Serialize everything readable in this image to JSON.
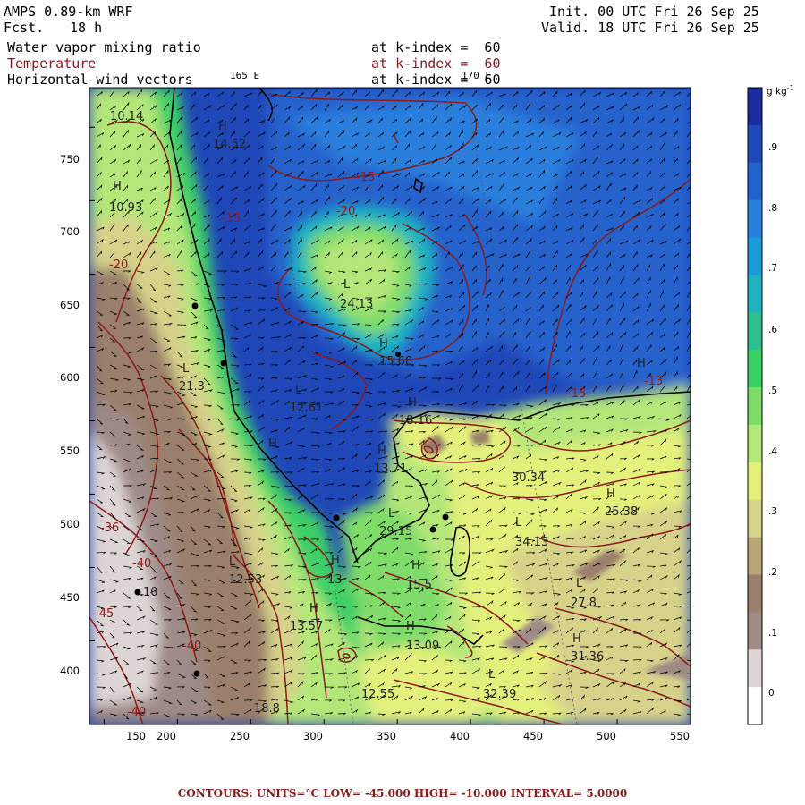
{
  "header": {
    "model": "AMPS 0.89-km WRF",
    "forecast_label": "Fcst.",
    "forecast_value": "18 h",
    "init": "Init. 00 UTC Fri 26 Sep 25",
    "valid": "Valid. 18 UTC Fri 26 Sep 25"
  },
  "fields": [
    {
      "name": "Water vapor mixing ratio",
      "level": "at k-index =  60",
      "color": "#000000"
    },
    {
      "name": "Temperature",
      "level": "at k-index =  60",
      "color": "#8b1a1a"
    },
    {
      "name": "Horizontal wind vectors",
      "level": "at k-index =  60",
      "color": "#000000"
    }
  ],
  "longitude_labels": [
    "165 E",
    "170 E"
  ],
  "axes": {
    "x_ticks": [
      "150",
      "200",
      "250",
      "300",
      "350",
      "400",
      "450",
      "500",
      "550"
    ],
    "y_ticks": [
      "750",
      "700",
      "650",
      "600",
      "550",
      "500",
      "450",
      "400"
    ]
  },
  "colorbar": {
    "unit": "g kg",
    "unit_sup": "-1",
    "labels": [
      ".9",
      ".8",
      ".7",
      ".6",
      ".5",
      ".4",
      ".3",
      ".2",
      ".1",
      "0"
    ],
    "colors": [
      "#1a2d9a",
      "#1f47b8",
      "#2562cc",
      "#2a7fdd",
      "#1b9bd6",
      "#1fb3bf",
      "#2ebf8c",
      "#3ccf66",
      "#7fdc6a",
      "#b4e67a",
      "#e4f07c",
      "#d6d28a",
      "#b8a77a",
      "#9a7f6c",
      "#9e8a86",
      "#ddd5d4",
      "#ffffff"
    ]
  },
  "map_labels": [
    {
      "text": "10.14",
      "kind": "value"
    },
    {
      "text": "14.52",
      "kind": "value"
    },
    {
      "text": "-15",
      "kind": "contour"
    },
    {
      "text": "10.93",
      "kind": "value"
    },
    {
      "text": "-20",
      "kind": "contour"
    },
    {
      "text": "-15",
      "kind": "contour"
    },
    {
      "text": "-20",
      "kind": "contour"
    },
    {
      "text": "24.13",
      "kind": "value"
    },
    {
      "text": "15.68",
      "kind": "value"
    },
    {
      "text": "21.3",
      "kind": "value"
    },
    {
      "text": "12.61",
      "kind": "value"
    },
    {
      "text": "18.16",
      "kind": "value"
    },
    {
      "text": "-15",
      "kind": "contour"
    },
    {
      "text": "-13",
      "kind": "contour"
    },
    {
      "text": "13.71",
      "kind": "value"
    },
    {
      "text": "30.34",
      "kind": "value"
    },
    {
      "text": "25.38",
      "kind": "value"
    },
    {
      "text": "-36",
      "kind": "contour"
    },
    {
      "text": "29.15",
      "kind": "value"
    },
    {
      "text": "34.13",
      "kind": "value"
    },
    {
      "text": "-40",
      "kind": "contour"
    },
    {
      "text": "12.53",
      "kind": "value"
    },
    {
      "text": "15.5",
      "kind": "value"
    },
    {
      "text": "13",
      "kind": "value"
    },
    {
      "text": "-45",
      "kind": "contour"
    },
    {
      "text": "10",
      "kind": "value"
    },
    {
      "text": "27.8",
      "kind": "value"
    },
    {
      "text": "13.57",
      "kind": "value"
    },
    {
      "text": "13.09",
      "kind": "value"
    },
    {
      "text": "31.36",
      "kind": "value"
    },
    {
      "text": "-40",
      "kind": "contour"
    },
    {
      "text": "32.39",
      "kind": "value"
    },
    {
      "text": "12.55",
      "kind": "value"
    },
    {
      "text": "-40",
      "kind": "contour"
    },
    {
      "text": "18.8",
      "kind": "value"
    }
  ],
  "map_markers": [
    "H",
    "H",
    "L",
    "H",
    "L",
    "L",
    "H",
    "H",
    "H",
    "H",
    "H",
    "L",
    "L",
    "H",
    "L",
    "H",
    "H",
    "L",
    "H",
    "H",
    "L"
  ],
  "footer": "CONTOURS:  UNITS=°C  LOW= -45.000     HIGH= -10.000     INTERVAL=   5.0000"
}
